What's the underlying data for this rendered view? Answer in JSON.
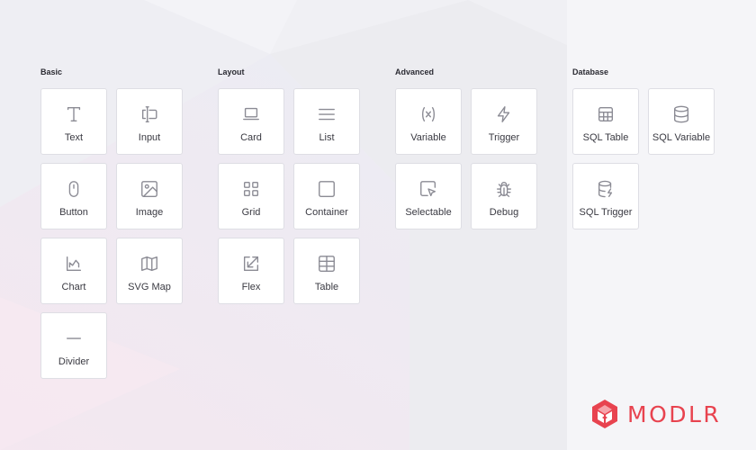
{
  "groups": {
    "basic": {
      "title": "Basic",
      "items": [
        {
          "label": "Text",
          "icon": "text-icon"
        },
        {
          "label": "Input",
          "icon": "input-icon"
        },
        {
          "label": "Button",
          "icon": "mouse-icon"
        },
        {
          "label": "Image",
          "icon": "image-icon"
        },
        {
          "label": "Chart",
          "icon": "chart-icon"
        },
        {
          "label": "SVG Map",
          "icon": "map-icon"
        },
        {
          "label": "Divider",
          "icon": "divider-icon"
        }
      ]
    },
    "layout": {
      "title": "Layout",
      "items": [
        {
          "label": "Card",
          "icon": "laptop-icon"
        },
        {
          "label": "List",
          "icon": "list-icon"
        },
        {
          "label": "Grid",
          "icon": "grid-icon"
        },
        {
          "label": "Container",
          "icon": "square-icon"
        },
        {
          "label": "Flex",
          "icon": "resize-icon"
        },
        {
          "label": "Table",
          "icon": "table-icon"
        }
      ]
    },
    "advanced": {
      "title": "Advanced",
      "items": [
        {
          "label": "Variable",
          "icon": "variable-icon"
        },
        {
          "label": "Trigger",
          "icon": "lightning-icon"
        },
        {
          "label": "Selectable",
          "icon": "cursor-select-icon"
        },
        {
          "label": "Debug",
          "icon": "bug-icon"
        }
      ]
    },
    "database": {
      "title": "Database",
      "items": [
        {
          "label": "SQL Table",
          "icon": "table-icon"
        },
        {
          "label": "SQL Variable",
          "icon": "database-icon"
        },
        {
          "label": "SQL Trigger",
          "icon": "database-lightning-icon"
        }
      ]
    }
  },
  "brand": {
    "name": "MODLR",
    "color": "#e8434f",
    "icon": "modlr-logo-icon"
  },
  "colors": {
    "tile_bg": "#ffffff",
    "tile_border": "#dedee4",
    "icon_stroke": "#8b8b94",
    "page_bg": "#f1f1f5"
  }
}
